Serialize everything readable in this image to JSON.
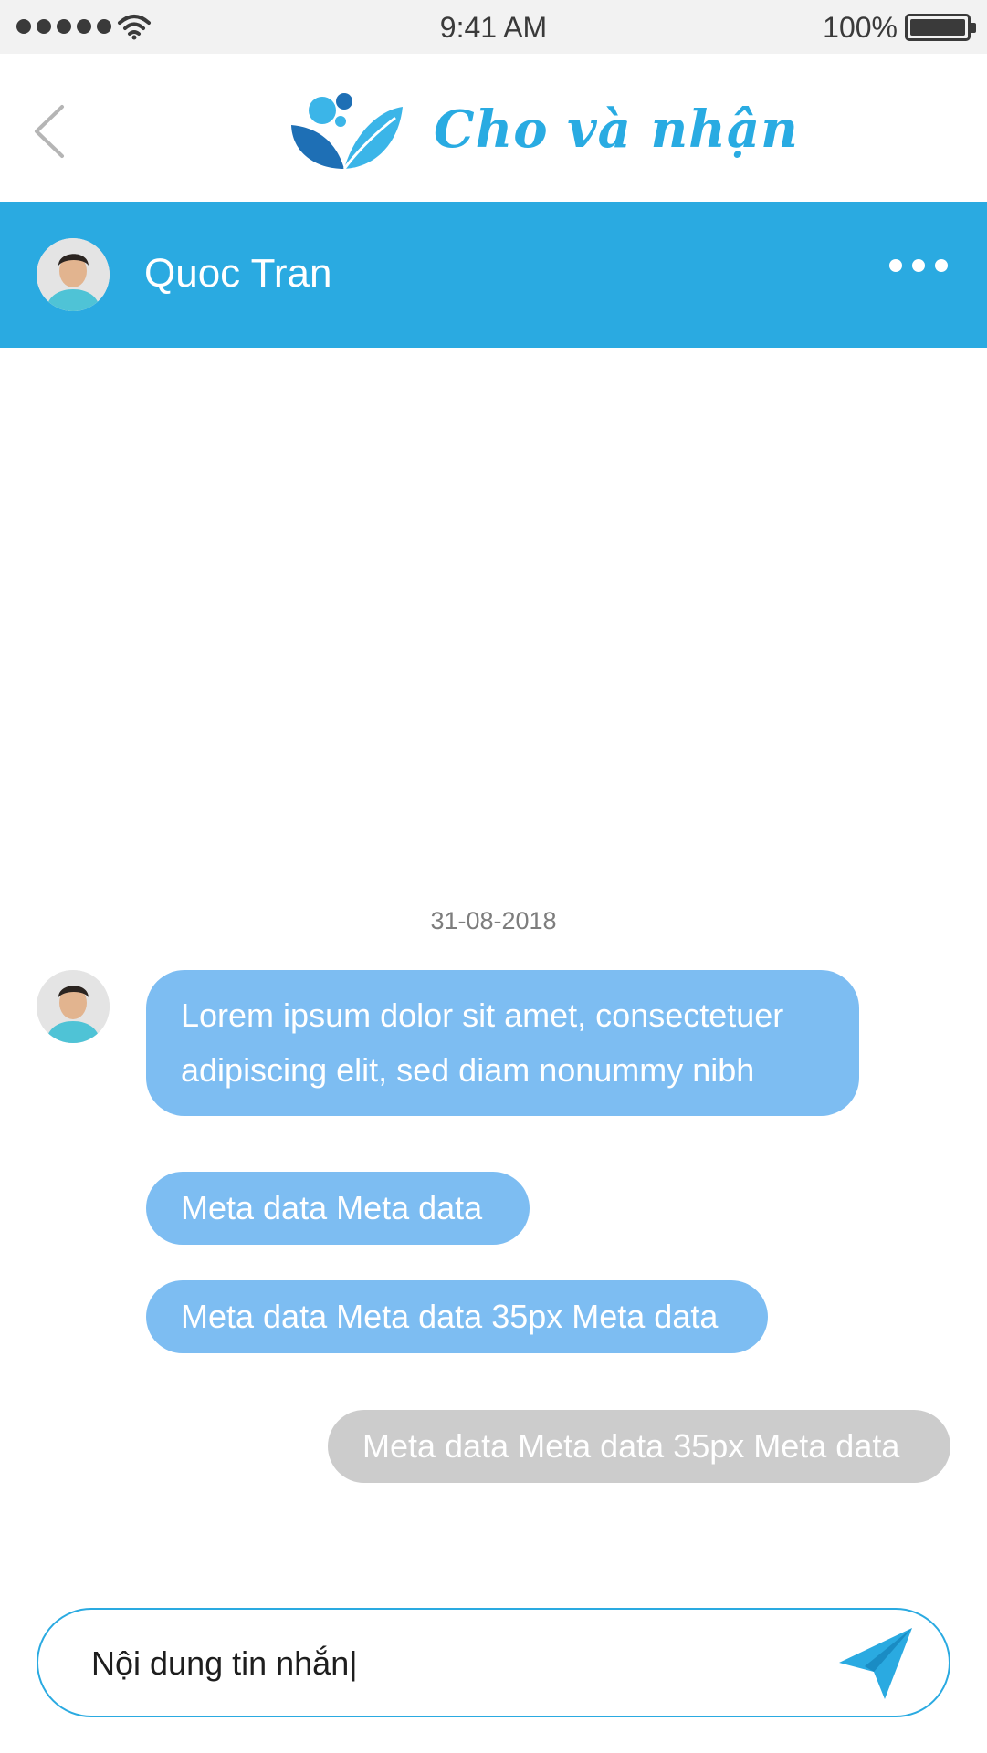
{
  "status_bar": {
    "time": "9:41 AM",
    "battery": "100%"
  },
  "app_header": {
    "logo_text": "Cho và nhận"
  },
  "chat_header": {
    "name": "Quoc Tran"
  },
  "conversation": {
    "date": "31-08-2018",
    "messages": [
      {
        "side": "incoming",
        "text_line1": "Lorem ipsum dolor sit amet, consectetuer",
        "text_line2": "adipiscing elit, sed diam nonummy nibh"
      },
      {
        "side": "incoming",
        "text": "Meta data Meta data"
      },
      {
        "side": "incoming",
        "text": "Meta data Meta data 35px Meta data"
      },
      {
        "side": "outgoing",
        "text": "Meta data Meta data 35px Meta data"
      }
    ]
  },
  "composer": {
    "value": "Nội dung tin nhắn|"
  },
  "colors": {
    "accent": "#2aaae1",
    "incoming_bubble": "#7dbdf2",
    "outgoing_bubble": "#cccccc",
    "logo_dark": "#1e6fb5",
    "logo_light": "#3bb5e8"
  },
  "icons": {
    "back": "chevron-left-icon",
    "more": "more-horizontal-icon",
    "send": "paper-plane-icon",
    "wifi": "wifi-icon",
    "battery": "battery-icon"
  }
}
